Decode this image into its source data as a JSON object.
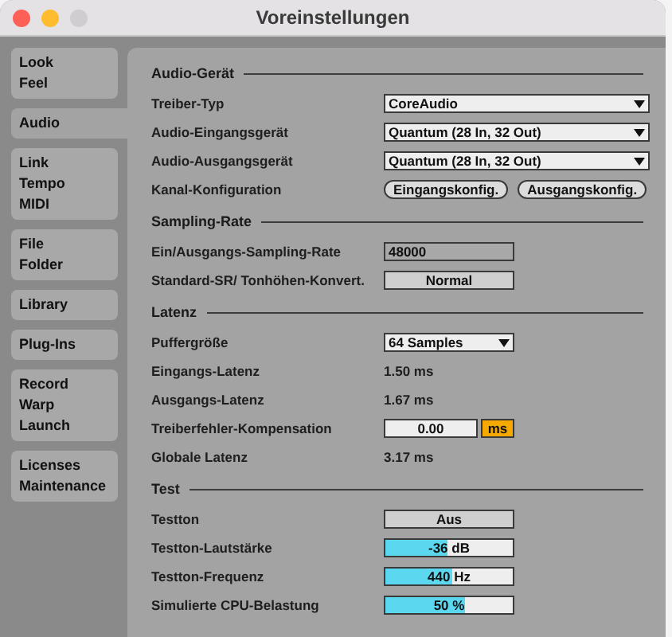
{
  "window": {
    "title": "Voreinstellungen"
  },
  "sidebar": {
    "tabs": [
      {
        "lines": [
          "Look",
          "Feel"
        ],
        "selected": false
      },
      {
        "lines": [
          "Audio"
        ],
        "selected": true
      },
      {
        "lines": [
          "Link",
          "Tempo",
          "MIDI"
        ],
        "selected": false
      },
      {
        "lines": [
          "File",
          "Folder"
        ],
        "selected": false
      },
      {
        "lines": [
          "Library"
        ],
        "selected": false
      },
      {
        "lines": [
          "Plug-Ins"
        ],
        "selected": false
      },
      {
        "lines": [
          "Record",
          "Warp",
          "Launch"
        ],
        "selected": false
      },
      {
        "lines": [
          "Licenses",
          "Maintenance"
        ],
        "selected": false
      }
    ]
  },
  "sections": [
    {
      "title": "Audio-Gerät",
      "rows": [
        {
          "kind": "dropdown",
          "label": "Treiber-Typ",
          "value": "CoreAudio",
          "wide": true
        },
        {
          "kind": "dropdown",
          "label": "Audio-Eingangsgerät",
          "value": "Quantum (28 In, 32 Out)",
          "wide": true
        },
        {
          "kind": "dropdown",
          "label": "Audio-Ausgangsgerät",
          "value": "Quantum (28 In, 32 Out)",
          "wide": true
        },
        {
          "kind": "buttons",
          "label": "Kanal-Konfiguration",
          "buttons": [
            "Eingangskonfig.",
            "Ausgangskonfig."
          ]
        }
      ]
    },
    {
      "title": "Sampling-Rate",
      "rows": [
        {
          "kind": "field",
          "label": "Ein/Ausgangs-Sampling-Rate",
          "value": "48000"
        },
        {
          "kind": "toggle",
          "label": "Standard-SR/ Tonhöhen-Konvert.",
          "value": "Normal"
        }
      ]
    },
    {
      "title": "Latenz",
      "rows": [
        {
          "kind": "dropdown",
          "label": "Puffergröße",
          "value": "64 Samples",
          "wide": false
        },
        {
          "kind": "text",
          "label": "Eingangs-Latenz",
          "value": "1.50 ms"
        },
        {
          "kind": "text",
          "label": "Ausgangs-Latenz",
          "value": "1.67 ms"
        },
        {
          "kind": "number_unit",
          "label": "Treiberfehler-Kompensation",
          "value": "0.00",
          "unit": "ms"
        },
        {
          "kind": "text",
          "label": "Globale Latenz",
          "value": "3.17 ms"
        }
      ]
    },
    {
      "title": "Test",
      "rows": [
        {
          "kind": "toggle",
          "label": "Testton",
          "value": "Aus"
        },
        {
          "kind": "slider",
          "label": "Testton-Lautstärke",
          "value": "-36 dB",
          "level": 0.49
        },
        {
          "kind": "slider",
          "label": "Testton-Frequenz",
          "value": "440 Hz",
          "level": 0.53
        },
        {
          "kind": "slider",
          "label": "Simulierte CPU-Belastung",
          "value": "50 %",
          "level": 0.62
        }
      ]
    }
  ]
}
